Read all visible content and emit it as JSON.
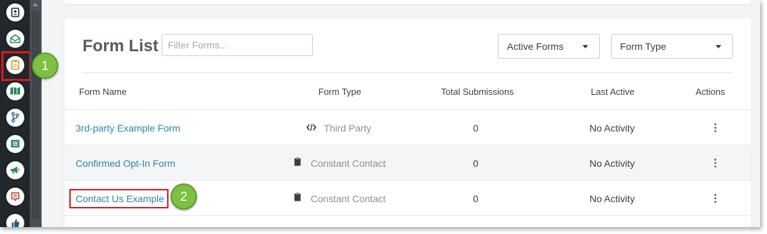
{
  "sidebar": {
    "items": [
      {
        "icon": "contact-card-icon"
      },
      {
        "icon": "mail-open-icon"
      },
      {
        "icon": "clipboard-icon",
        "active": true
      },
      {
        "icon": "map-icon"
      },
      {
        "icon": "branch-icon"
      },
      {
        "icon": "list-icon"
      },
      {
        "icon": "megaphone-icon"
      },
      {
        "icon": "chat-bubble-icon"
      },
      {
        "icon": "thumbs-up-icon"
      }
    ]
  },
  "form_list": {
    "title": "Form List",
    "filter_placeholder": "Filter Forms...",
    "active_filter": "Active Forms",
    "type_filter": "Form Type",
    "columns": {
      "name": "Form Name",
      "type": "Form Type",
      "submissions": "Total Submissions",
      "last_active": "Last Active",
      "actions": "Actions"
    },
    "rows": [
      {
        "name": "3rd-party Example Form",
        "type": "Third Party",
        "type_icon": "code-icon",
        "submissions": "0",
        "last_active": "No Activity"
      },
      {
        "name": "Confirmed Opt-In Form",
        "type": "Constant Contact",
        "type_icon": "clipboard-icon",
        "submissions": "0",
        "last_active": "No Activity"
      },
      {
        "name": "Contact Us Example",
        "type": "Constant Contact",
        "type_icon": "clipboard-icon",
        "submissions": "0",
        "last_active": "No Activity"
      }
    ]
  },
  "callouts": {
    "step1": "1",
    "step2": "2"
  },
  "colors": {
    "sidebar_bg": "#21272b",
    "link": "#2f86a6",
    "highlight": "#e0171f",
    "callout": "#7dc142"
  }
}
